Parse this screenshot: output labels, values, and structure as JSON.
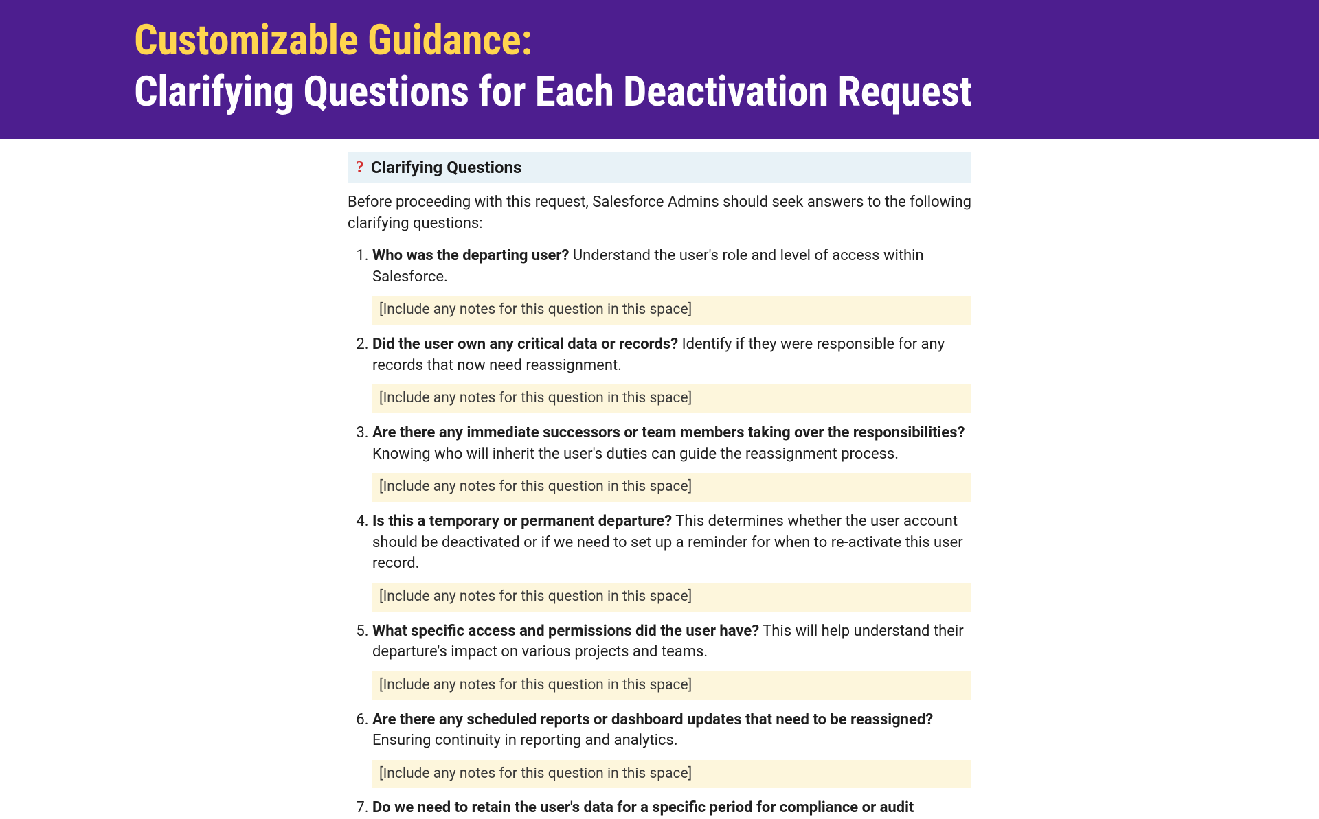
{
  "header": {
    "line1": "Customizable Guidance:",
    "line2": "Clarifying Questions for Each Deactivation Request"
  },
  "section": {
    "icon": "?",
    "title": "Clarifying Questions",
    "intro": "Before proceeding with this request, Salesforce Admins should seek answers to the following clarifying questions:"
  },
  "note_placeholder": "[Include any notes for this question in this space]",
  "questions": [
    {
      "bold": "Who was the departing user?",
      "desc": " Understand the user's role and level of access within Salesforce."
    },
    {
      "bold": "Did the user own any critical data or records?",
      "desc": " Identify if they were responsible for any records that now need reassignment."
    },
    {
      "bold": "Are there any immediate successors or team members taking over the responsibilities?",
      "desc": " Knowing who will inherit the user's duties can guide the reassignment process."
    },
    {
      "bold": "Is this a temporary or permanent departure?",
      "desc": " This determines whether the user account should be deactivated or if we need to set up a reminder for when to re-activate this user record."
    },
    {
      "bold": "What specific access and permissions did the user have?",
      "desc": " This will help understand their departure's impact on various projects and teams."
    },
    {
      "bold": "Are there any scheduled reports or dashboard updates that need to be reassigned?",
      "desc": " Ensuring continuity in reporting and analytics."
    },
    {
      "bold": "Do we need to retain the user's data for a specific period for compliance or audit",
      "desc": ""
    }
  ]
}
